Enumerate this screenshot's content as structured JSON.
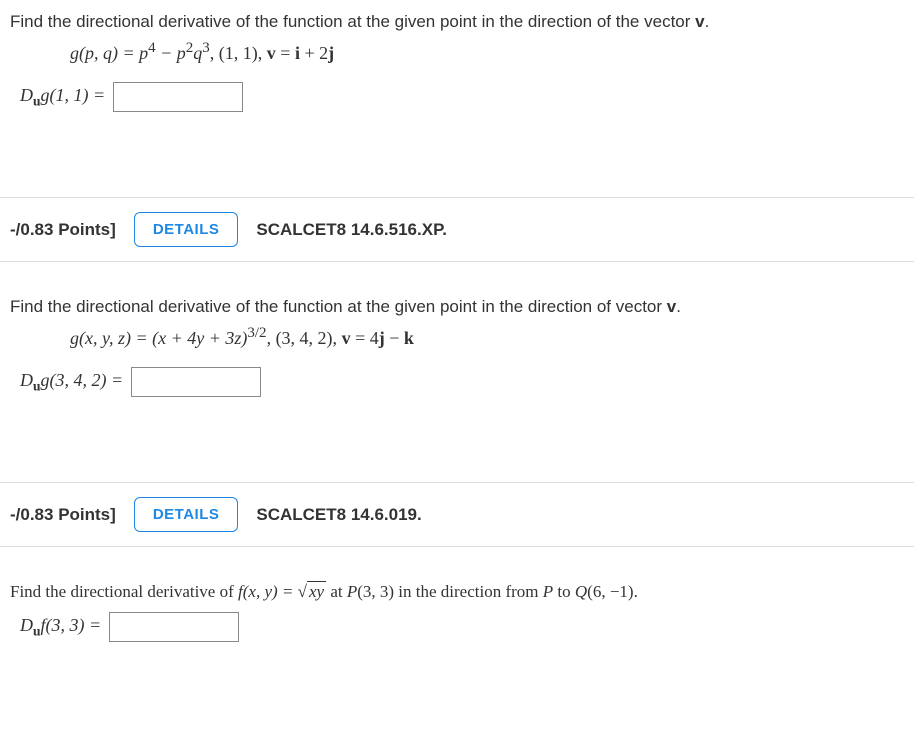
{
  "q1": {
    "prompt": "Find the directional derivative of the function at the given point in the direction of the vector ",
    "prompt_bold": "v",
    "prompt_end": ".",
    "formula_func": "g(p, q) = p",
    "formula_exp1": "4",
    "formula_mid": " − p",
    "formula_exp2": "2",
    "formula_var2": "q",
    "formula_exp3": "3",
    "formula_point": ",    (1, 1),    ",
    "formula_vec_lhs": "v",
    "formula_vec_eq": " = ",
    "formula_vec_rhs1": "i",
    "formula_vec_plus": " + 2",
    "formula_vec_rhs2": "j",
    "answer_lhs1": "D",
    "answer_sub": "u",
    "answer_lhs2": "g(1, 1) = "
  },
  "q2": {
    "points": "-/0.83 Points]",
    "details": "DETAILS",
    "source": "SCALCET8 14.6.516.XP.",
    "prompt": "Find the directional derivative of the function at the given point in the direction of vector ",
    "prompt_bold": "v",
    "prompt_end": ".",
    "formula_func": "g(x, y, z) = (x + 4y + 3z)",
    "formula_exp": "3/2",
    "formula_point": ",     (3, 4, 2),     ",
    "formula_vec_lhs": "v",
    "formula_vec_eq": " = 4",
    "formula_vec_rhs1": "j",
    "formula_vec_minus": " − ",
    "formula_vec_rhs2": "k",
    "answer_lhs1": "D",
    "answer_sub": "u",
    "answer_lhs2": "g(3, 4, 2) = "
  },
  "q3": {
    "points": "-/0.83 Points]",
    "details": "DETAILS",
    "source": "SCALCET8 14.6.019.",
    "prompt1": "Find the directional derivative of ",
    "formula_func": "f(x, y) = ",
    "sqrt_content": "xy",
    "prompt2": " at P(3, 3) in the direction from P to Q(6, −1).",
    "answer_lhs1": "D",
    "answer_sub": "u",
    "answer_lhs2": "f(3, 3) = "
  }
}
